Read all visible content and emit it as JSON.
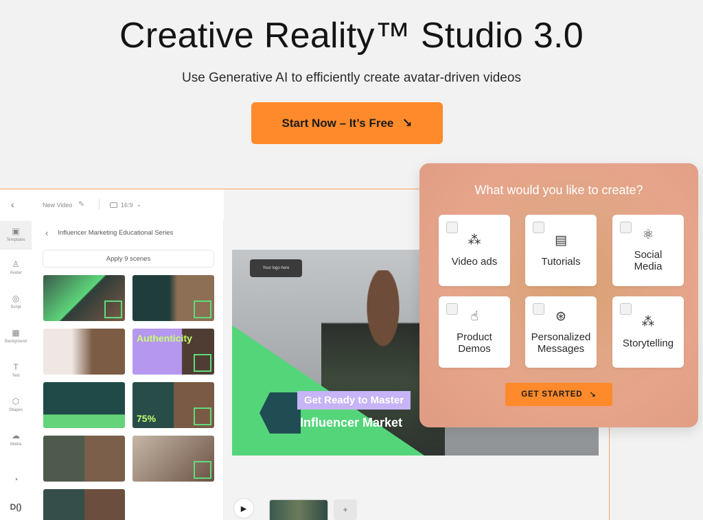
{
  "hero": {
    "title": "Creative Reality™ Studio 3.0",
    "subtitle": "Use Generative AI to efficiently create avatar-driven videos",
    "cta_label": "Start Now – It’s Free",
    "cta_arrow": "↘"
  },
  "editor": {
    "back_icon": "‹",
    "video_title": "New Video",
    "aspect_ratio": "16:9",
    "rail": [
      {
        "label": "Templates",
        "icon": "▣"
      },
      {
        "label": "Avatar",
        "icon": "♙"
      },
      {
        "label": "Script",
        "icon": "◎"
      },
      {
        "label": "Background",
        "icon": "▦"
      },
      {
        "label": "Text",
        "icon": "T"
      },
      {
        "label": "Shapes",
        "icon": "⬡"
      },
      {
        "label": "Media",
        "icon": "☁"
      }
    ],
    "panel_title": "Influencer Marketing Educational Series",
    "apply_label": "Apply 9 scenes",
    "thumb_labels": {
      "authenticity": "Authenticity",
      "percent": "75%"
    },
    "logo_pill": "Your logo here",
    "caption_1": "Get Ready to Master",
    "caption_2": "Influencer Market"
  },
  "create_card": {
    "title": "What would you like to create?",
    "options": [
      {
        "label": "Video ads",
        "icon": "magic-wand-icon"
      },
      {
        "label": "Tutorials",
        "icon": "presentation-icon"
      },
      {
        "label": "Social Media",
        "icon": "atom-icon"
      },
      {
        "label": "Product Demos",
        "icon": "hand-pointer-icon"
      },
      {
        "label": "Personalized Messages",
        "icon": "network-icon"
      },
      {
        "label": "Storytelling",
        "icon": "magic-wand-icon"
      }
    ],
    "button_label": "GET STARTED",
    "button_arrow": "↘"
  },
  "colors": {
    "accent": "#ff8a2b",
    "green": "#55d57a",
    "purple": "#c6b4f7"
  }
}
